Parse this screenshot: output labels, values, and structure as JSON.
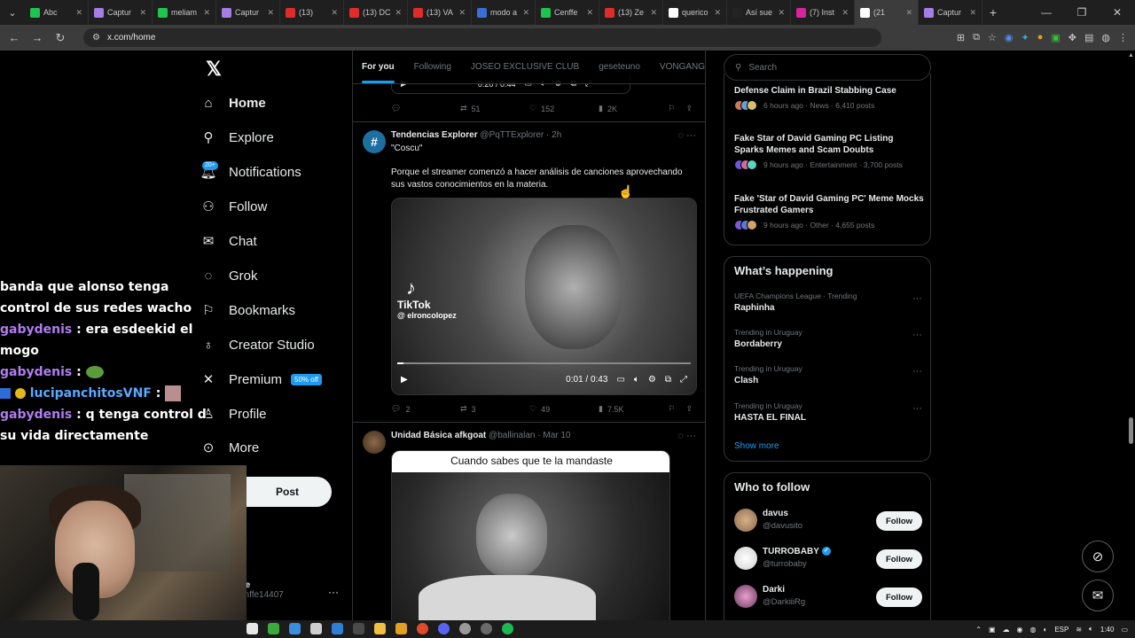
{
  "browser": {
    "tabs": [
      {
        "label": "Abc",
        "color": "#1fc44f"
      },
      {
        "label": "Captur",
        "color": "#a57de6"
      },
      {
        "label": "meliam",
        "color": "#1fc44f"
      },
      {
        "label": "Captur",
        "color": "#a57de6"
      },
      {
        "label": "(13)",
        "color": "#e02b2b"
      },
      {
        "label": "(13) DC",
        "color": "#e02b2b"
      },
      {
        "label": "(13) VA",
        "color": "#e02b2b"
      },
      {
        "label": "modo a",
        "color": "#3b6fd6"
      },
      {
        "label": "Cenffe",
        "color": "#1fc44f"
      },
      {
        "label": "(13) Ze",
        "color": "#e02b2b"
      },
      {
        "label": "querico",
        "color": "#ffffff"
      },
      {
        "label": "Así sue",
        "color": "#222222"
      },
      {
        "label": "(7) Inst",
        "color": "#d6249f"
      },
      {
        "label": "(21",
        "color": "#ffffff"
      },
      {
        "label": "Captur",
        "color": "#a57de6"
      }
    ],
    "url": "x.com/home"
  },
  "nav": {
    "home": "Home",
    "explore": "Explore",
    "notifications": "Notifications",
    "notif_badge": "20+",
    "follow": "Follow",
    "chat": "Chat",
    "grok": "Grok",
    "bookmarks": "Bookmarks",
    "creator_studio": "Creator Studio",
    "premium": "Premium",
    "premium_badge": "50% off",
    "profile": "Profile",
    "more": "More",
    "post": "Post",
    "account_name": "ffe",
    "account_handle": "enffe14407"
  },
  "chat": {
    "line1": "banda que alonso tenga control de sus redes wacho",
    "l2_user": "gabydenis",
    "l2_text": ": era esdeekid el mogo",
    "l3_user": "gabydenis",
    "l3_text": ":",
    "l4_user": "lucipanchitosVNF",
    "l4_text": ":",
    "l5_user": "gabydenis",
    "l5_text": ": q tenga control d su vida directamente"
  },
  "feed": {
    "tabs": [
      "For you",
      "Following",
      "JOSEO EXCLUSIVE CLUB",
      "geseteuno",
      "VONGANG"
    ],
    "prev_actions": {
      "reposts": "51",
      "likes": "152",
      "views": "2K"
    },
    "prev_time": "0:20 / 0:44",
    "tweet1": {
      "name": "Tendencias Explorer",
      "handle": "@PqTTExplorer",
      "time": "· 2h",
      "line1": "\"Coscu\"",
      "line2": "Porque el streamer comenzó a hacer análisis de canciones aprovechando sus vastos conocimientos en la materia.",
      "tiktok": "TikTok",
      "tiktok_user": "@ elroncolopez",
      "video_time": "0:01 / 0:43",
      "video_progress": 0.02,
      "replies": "2",
      "reposts": "3",
      "likes": "49",
      "views": "7.5K"
    },
    "tweet2": {
      "name": "Unidad Básica afkgoat",
      "handle": "@ballinalan",
      "time": "· Mar 10",
      "caption": "Cuando sabes que te la mandaste"
    }
  },
  "right": {
    "search_placeholder": "Search",
    "news": [
      {
        "title": "Defense Claim in Brazil Stabbing Case",
        "meta": "6 hours ago · News · 6,410 posts"
      },
      {
        "title": "Fake Star of David Gaming PC Listing Sparks Memes and Scam Doubts",
        "meta": "9 hours ago · Entertainment · 3,700 posts"
      },
      {
        "title": "Fake 'Star of David Gaming PC' Meme Mocks Frustrated Gamers",
        "meta": "9 hours ago · Other · 4,655 posts"
      }
    ],
    "happening_title": "What’s happening",
    "trends": [
      {
        "context": "UEFA Champions League · Trending",
        "name": "Raphinha"
      },
      {
        "context": "Trending in Uruguay",
        "name": "Bordaberry"
      },
      {
        "context": "Trending in Uruguay",
        "name": "Clash"
      },
      {
        "context": "Trending in Uruguay",
        "name": "HASTA EL FINAL"
      }
    ],
    "show_more": "Show more",
    "wtf_title": "Who to follow",
    "follow_label": "Follow",
    "who": [
      {
        "name": "davus",
        "handle": "@davusito"
      },
      {
        "name": "TURROBABY",
        "handle": "@turrobaby"
      },
      {
        "name": "Darki",
        "handle": "@DarkiiiRg"
      }
    ]
  },
  "taskbar": {
    "lang": "ESP",
    "time": "1:40"
  }
}
